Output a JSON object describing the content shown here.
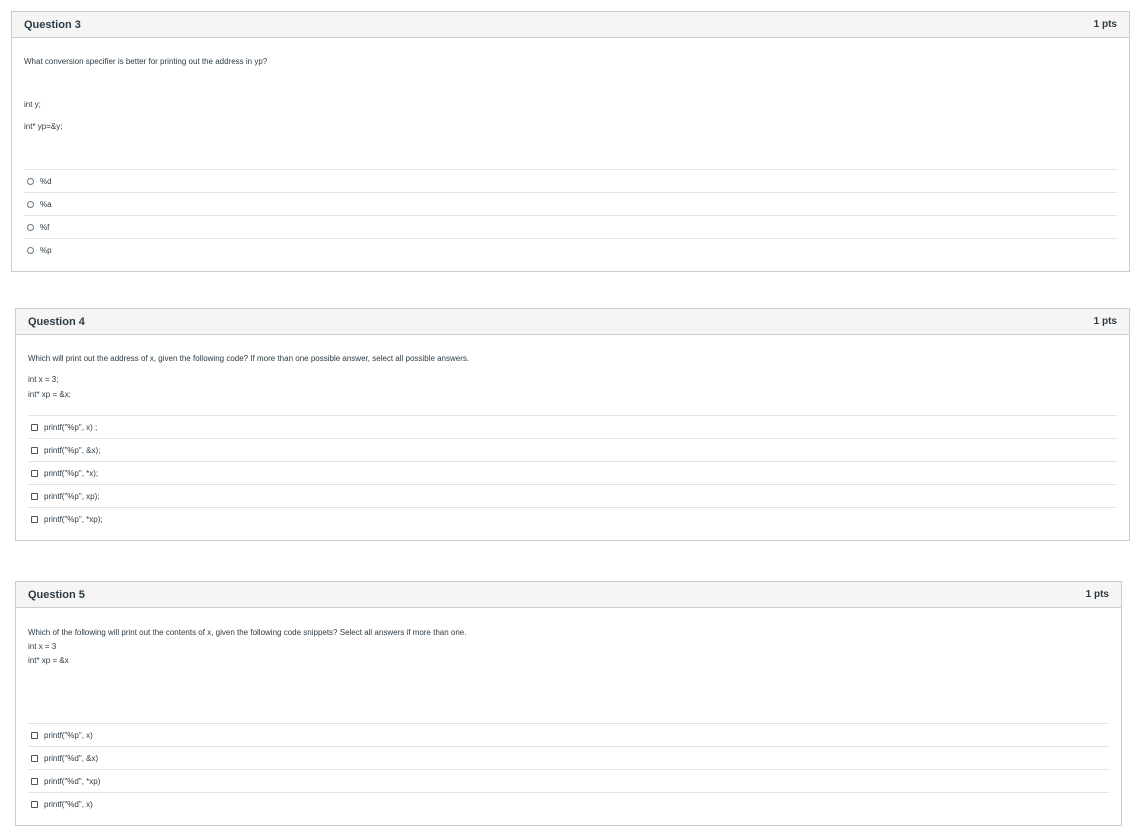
{
  "questions": [
    {
      "title": "Question 3",
      "points": "1 pts",
      "prompt": "What conversion specifier is better for printing out the address  in yp?",
      "code": [
        "int y;",
        "int* yp=&y;"
      ],
      "answer_type": "radio",
      "answers": [
        "%d",
        "%a",
        "%f",
        "%p"
      ]
    },
    {
      "title": "Question 4",
      "points": "1 pts",
      "prompt": "Which will print out the address of x, given the following code?  If more than one possible answer, select all possible answers.",
      "code": [
        "int x = 3;",
        "int* xp = &x;"
      ],
      "answer_type": "checkbox",
      "answers": [
        "printf(\"%p\", x) ;",
        "printf(\"%p\", &x);",
        "printf(\"%p\", *x);",
        "printf(\"%p\", xp);",
        "printf(\"%p\", *xp);"
      ]
    },
    {
      "title": "Question 5",
      "points": "1 pts",
      "prompt": "Which of the following will print out the contents of x, given the following code snippets? Select all answers if more  than one.",
      "code": [
        "int x = 3",
        "int* xp = &x"
      ],
      "answer_type": "checkbox",
      "answers": [
        "printf(\"%p\", x)",
        "printf(\"%d\", &x)",
        "printf(\"%d\", *xp)",
        "printf(\"%d\", x)"
      ]
    }
  ]
}
